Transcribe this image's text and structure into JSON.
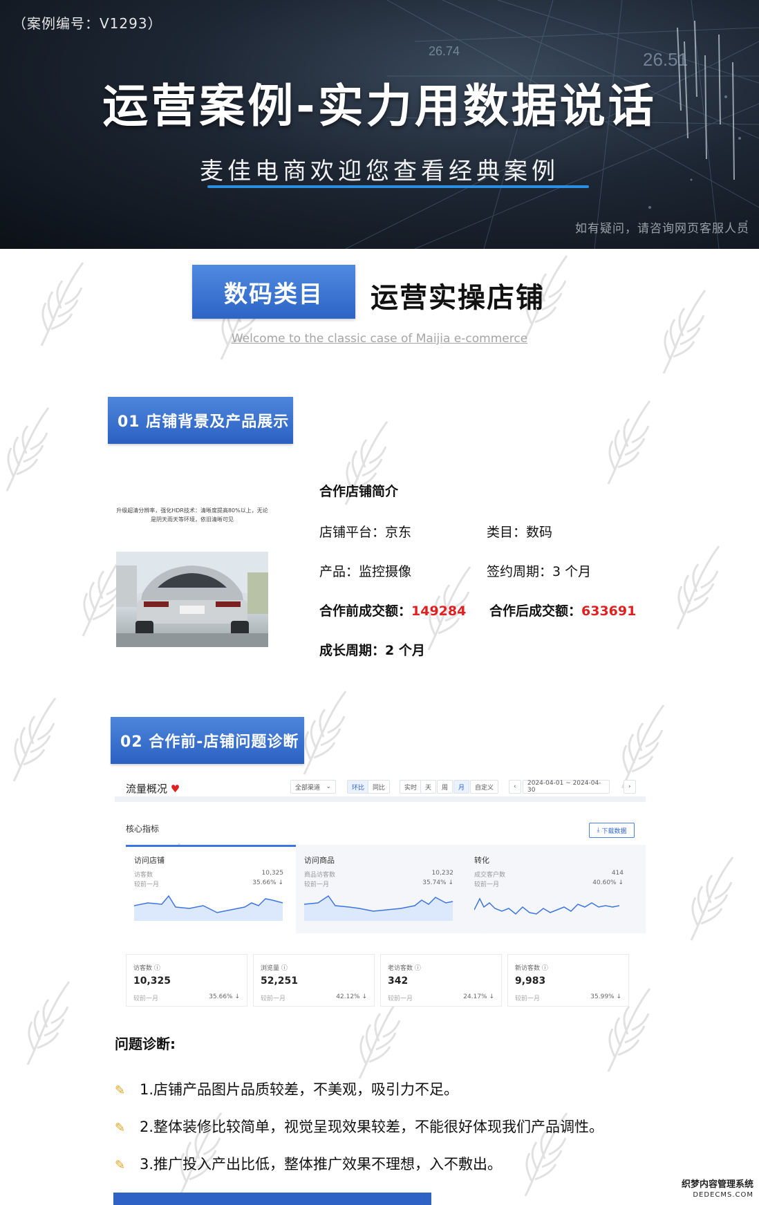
{
  "banner": {
    "case_no": "（案例编号：V1293）",
    "title": "运营案例-实力用数据说话",
    "subtitle": "麦佳电商欢迎您查看经典案例",
    "note": "如有疑问，请咨询网页客服人员",
    "bg_numbers": [
      "26.74",
      "26.51"
    ]
  },
  "category": {
    "box": "数码类目",
    "text": "运营实操店铺",
    "welcome": "Welcome to the classic case of Maijia e-commerce"
  },
  "section1": {
    "tag": "01 店铺背景及产品展示",
    "product_caption": "升级超清分辨率，强化HDR技术：清晰度提高80%以上，无论是阴天雨天等环境，依旧清晰可见",
    "intro_title": "合作店铺简介",
    "platform": "店铺平台：京东",
    "category": "类目：数码",
    "product": "产品：监控摄像",
    "period": "签约周期：3 个月",
    "before_label": "合作前成交额：",
    "before_value": "149284",
    "after_label": "合作后成交额：",
    "after_value": "633691",
    "growth": "成长周期：2 个月"
  },
  "section2": {
    "tag": "02 合作前-店铺问题诊断",
    "dashboard": {
      "title": "流量概况",
      "channel": "全部渠道",
      "compare": [
        "环比",
        "同比"
      ],
      "periods": [
        "实时",
        "天",
        "周",
        "月",
        "自定义"
      ],
      "date_range": "2024-04-01 ~ 2024-04-30",
      "core": "核心指标",
      "download": "下载数据",
      "tabs": [
        {
          "name": "访问店铺",
          "l1": "访客数",
          "v1": "10,325",
          "l2": "较前一月",
          "v2": "35.66% ↓"
        },
        {
          "name": "访问商品",
          "l1": "商品访客数",
          "v1": "10,232",
          "l2": "较前一月",
          "v2": "35.74% ↓"
        },
        {
          "name": "转化",
          "l1": "成交客户数",
          "v1": "414",
          "l2": "较前一月",
          "v2": "40.60% ↓"
        }
      ],
      "kpis": [
        {
          "label": "访客数 ⓘ",
          "value": "10,325",
          "cmp": "较前一月",
          "pct": "35.66% ↓"
        },
        {
          "label": "浏览量 ⓘ",
          "value": "52,251",
          "cmp": "较前一月",
          "pct": "42.12% ↓"
        },
        {
          "label": "老访客数 ⓘ",
          "value": "342",
          "cmp": "较前一月",
          "pct": "24.17% ↓"
        },
        {
          "label": "新访客数 ⓘ",
          "value": "9,983",
          "cmp": "较前一月",
          "pct": "35.99% ↓"
        }
      ]
    },
    "diag_title": "问题诊断:",
    "items": [
      "1.店铺产品图片品质较差，不美观，吸引力不足。",
      "2.整体装修比较简单，视觉呈现效果较差，不能很好体现我们产品调性。",
      "3.推广投入产出比低，整体推广效果不理想，入不敷出。"
    ]
  },
  "corner": {
    "line1": "织梦内容管理系统",
    "line2": "DEDECMS.COM"
  },
  "colors": {
    "accent": "#2d64c6",
    "red": "#e02020",
    "banner_bg": "#1d2633"
  }
}
